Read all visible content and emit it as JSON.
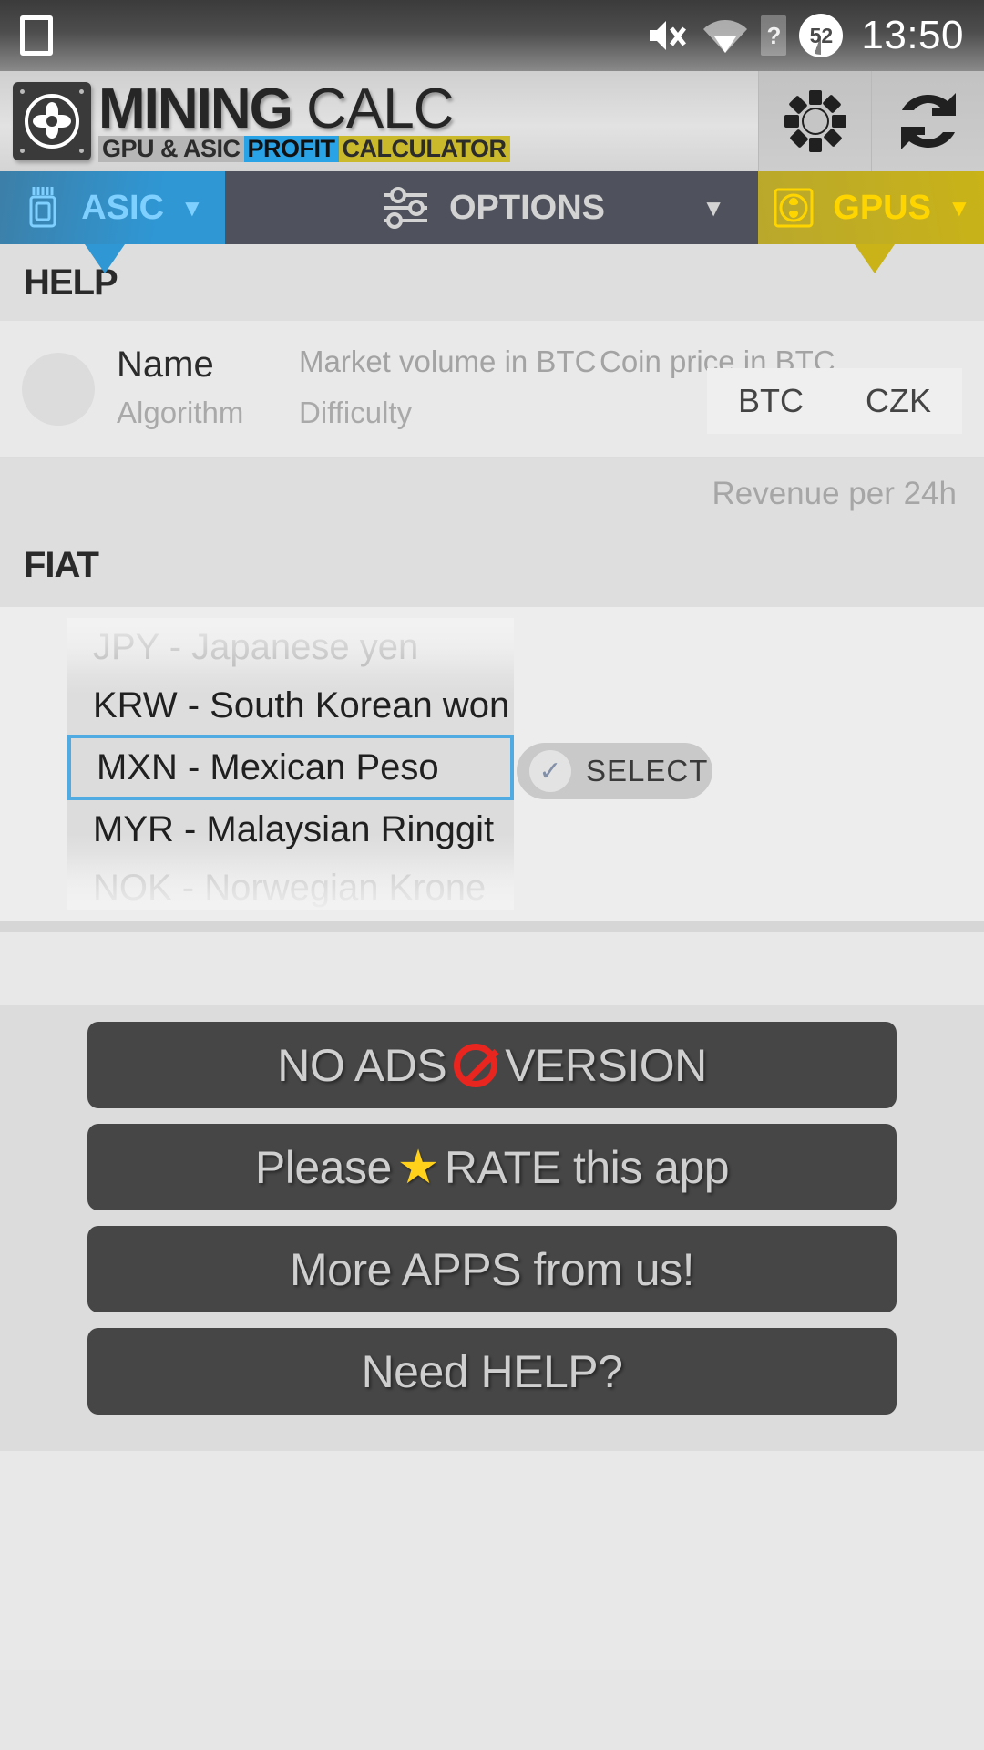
{
  "status_bar": {
    "screenshot_icon": "white-square-icon",
    "mute_icon": "mute-icon",
    "wifi_icon": "wifi-icon",
    "help_icon_label": "?",
    "battery_level": "52",
    "time": "13:50"
  },
  "header": {
    "logo_title_bold": "MINING",
    "logo_title_thin": " CALC",
    "logo_sub_gpu": "GPU & ASIC",
    "logo_sub_profit": "PROFIT",
    "logo_sub_calc": "CALCULATOR",
    "settings_icon": "gear-icon",
    "refresh_icon": "refresh-icon"
  },
  "tabs": [
    {
      "label": "ASIC",
      "icon": "chip-icon",
      "caret": "▼",
      "active": true,
      "color": "#2f97d4"
    },
    {
      "label": "OPTIONS",
      "icon": "sliders-icon",
      "caret": "▼",
      "active": false,
      "color": "#4f525c"
    },
    {
      "label": "GPUS",
      "icon": "gpu-fan-icon",
      "caret": "▼",
      "active": true,
      "color": "#c9b318"
    }
  ],
  "sections": {
    "help_title": "HELP",
    "fiat_title": "FIAT"
  },
  "coin_header": {
    "avatar": "coin-avatar-placeholder",
    "name": "Name",
    "market_volume": "Market volume in BTC",
    "coin_price": "Coin price in BTC",
    "algorithm": "Algorithm",
    "difficulty": "Difficulty",
    "currency_options": [
      "BTC",
      "CZK"
    ],
    "revenue_label": "Revenue per 24h"
  },
  "fiat_picker": {
    "items": [
      {
        "label": "JPY - Japanese yen",
        "state": "faded-top"
      },
      {
        "label": "KRW - South Korean won",
        "state": "normal"
      },
      {
        "label": "MXN - Mexican Peso",
        "state": "selected"
      },
      {
        "label": "MYR - Malaysian Ringgit",
        "state": "normal"
      },
      {
        "label": "NOK - Norwegian Krone",
        "state": "faded-bot"
      }
    ],
    "selected_value": "MXN - Mexican Peso",
    "highlight_color": "#4fabe2",
    "select_button": {
      "label": "SELECT",
      "icon": "check-icon",
      "check_glyph": "✓"
    }
  },
  "bottom_buttons": [
    {
      "text_before": "NO ADS",
      "icon": "prohibited-icon",
      "text_after": "VERSION",
      "name": "no-ads-version-button"
    },
    {
      "text_before": "Please",
      "icon": "star-icon",
      "text_after": "RATE this app",
      "name": "rate-app-button"
    },
    {
      "text_before": "More APPS from us!",
      "icon": "",
      "text_after": "",
      "name": "more-apps-button"
    },
    {
      "text_before": "Need HELP?",
      "icon": "",
      "text_after": "",
      "name": "need-help-button"
    }
  ]
}
